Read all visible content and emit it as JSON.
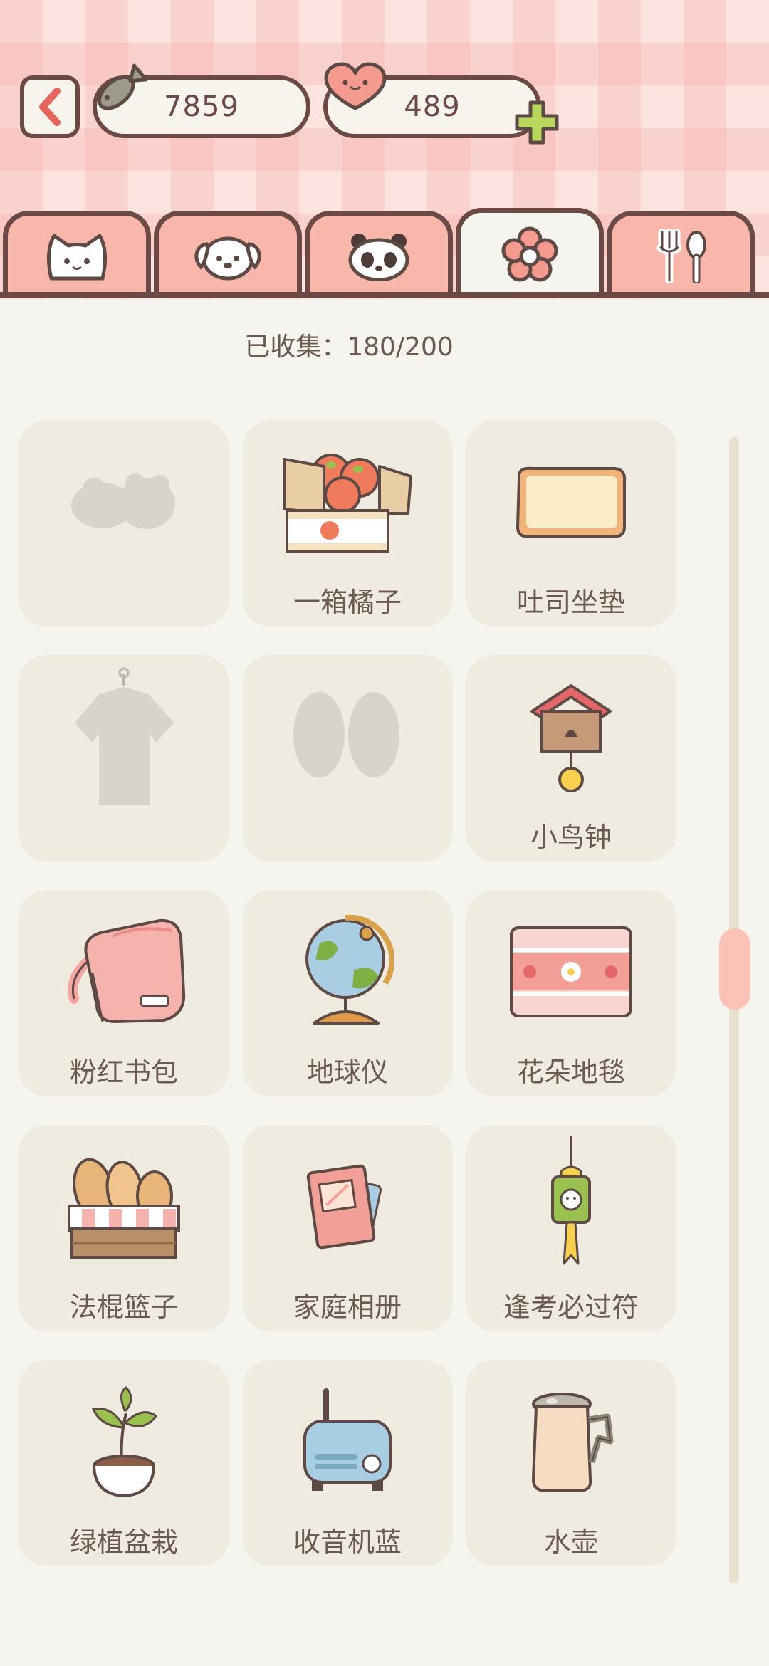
{
  "currency": {
    "fish_count": "7859",
    "heart_count": "489"
  },
  "tabs": [
    {
      "icon": "cat-icon"
    },
    {
      "icon": "dog-icon"
    },
    {
      "icon": "panda-icon"
    },
    {
      "icon": "flower-icon",
      "active": true
    },
    {
      "icon": "fork-spoon-icon"
    }
  ],
  "collection": {
    "status_text": "已收集：180/200"
  },
  "items": [
    {
      "label": "",
      "icon": "locked-slippers-icon",
      "locked": true
    },
    {
      "label": "一箱橘子",
      "icon": "orange-box-icon"
    },
    {
      "label": "吐司坐垫",
      "icon": "toast-cushion-icon"
    },
    {
      "label": "",
      "icon": "locked-shirt-icon",
      "locked": true
    },
    {
      "label": "",
      "icon": "locked-shoes-icon",
      "locked": true
    },
    {
      "label": "小鸟钟",
      "icon": "bird-clock-icon"
    },
    {
      "label": "粉红书包",
      "icon": "pink-backpack-icon"
    },
    {
      "label": "地球仪",
      "icon": "globe-icon"
    },
    {
      "label": "花朵地毯",
      "icon": "flower-rug-icon"
    },
    {
      "label": "法棍篮子",
      "icon": "baguette-basket-icon"
    },
    {
      "label": "家庭相册",
      "icon": "photo-album-icon"
    },
    {
      "label": "逢考必过符",
      "icon": "exam-charm-icon"
    },
    {
      "label": "绿植盆栽",
      "icon": "potted-plant-icon"
    },
    {
      "label": "收音机蓝",
      "icon": "blue-radio-icon"
    },
    {
      "label": "水壶",
      "icon": "kettle-icon"
    }
  ],
  "colors": {
    "outline": "#6b4a46",
    "tab_pink": "#f9b7ab",
    "card_bg": "#efebe0",
    "page_bg": "#f6f4ef",
    "scroll_thumb": "#fbc3b8"
  }
}
